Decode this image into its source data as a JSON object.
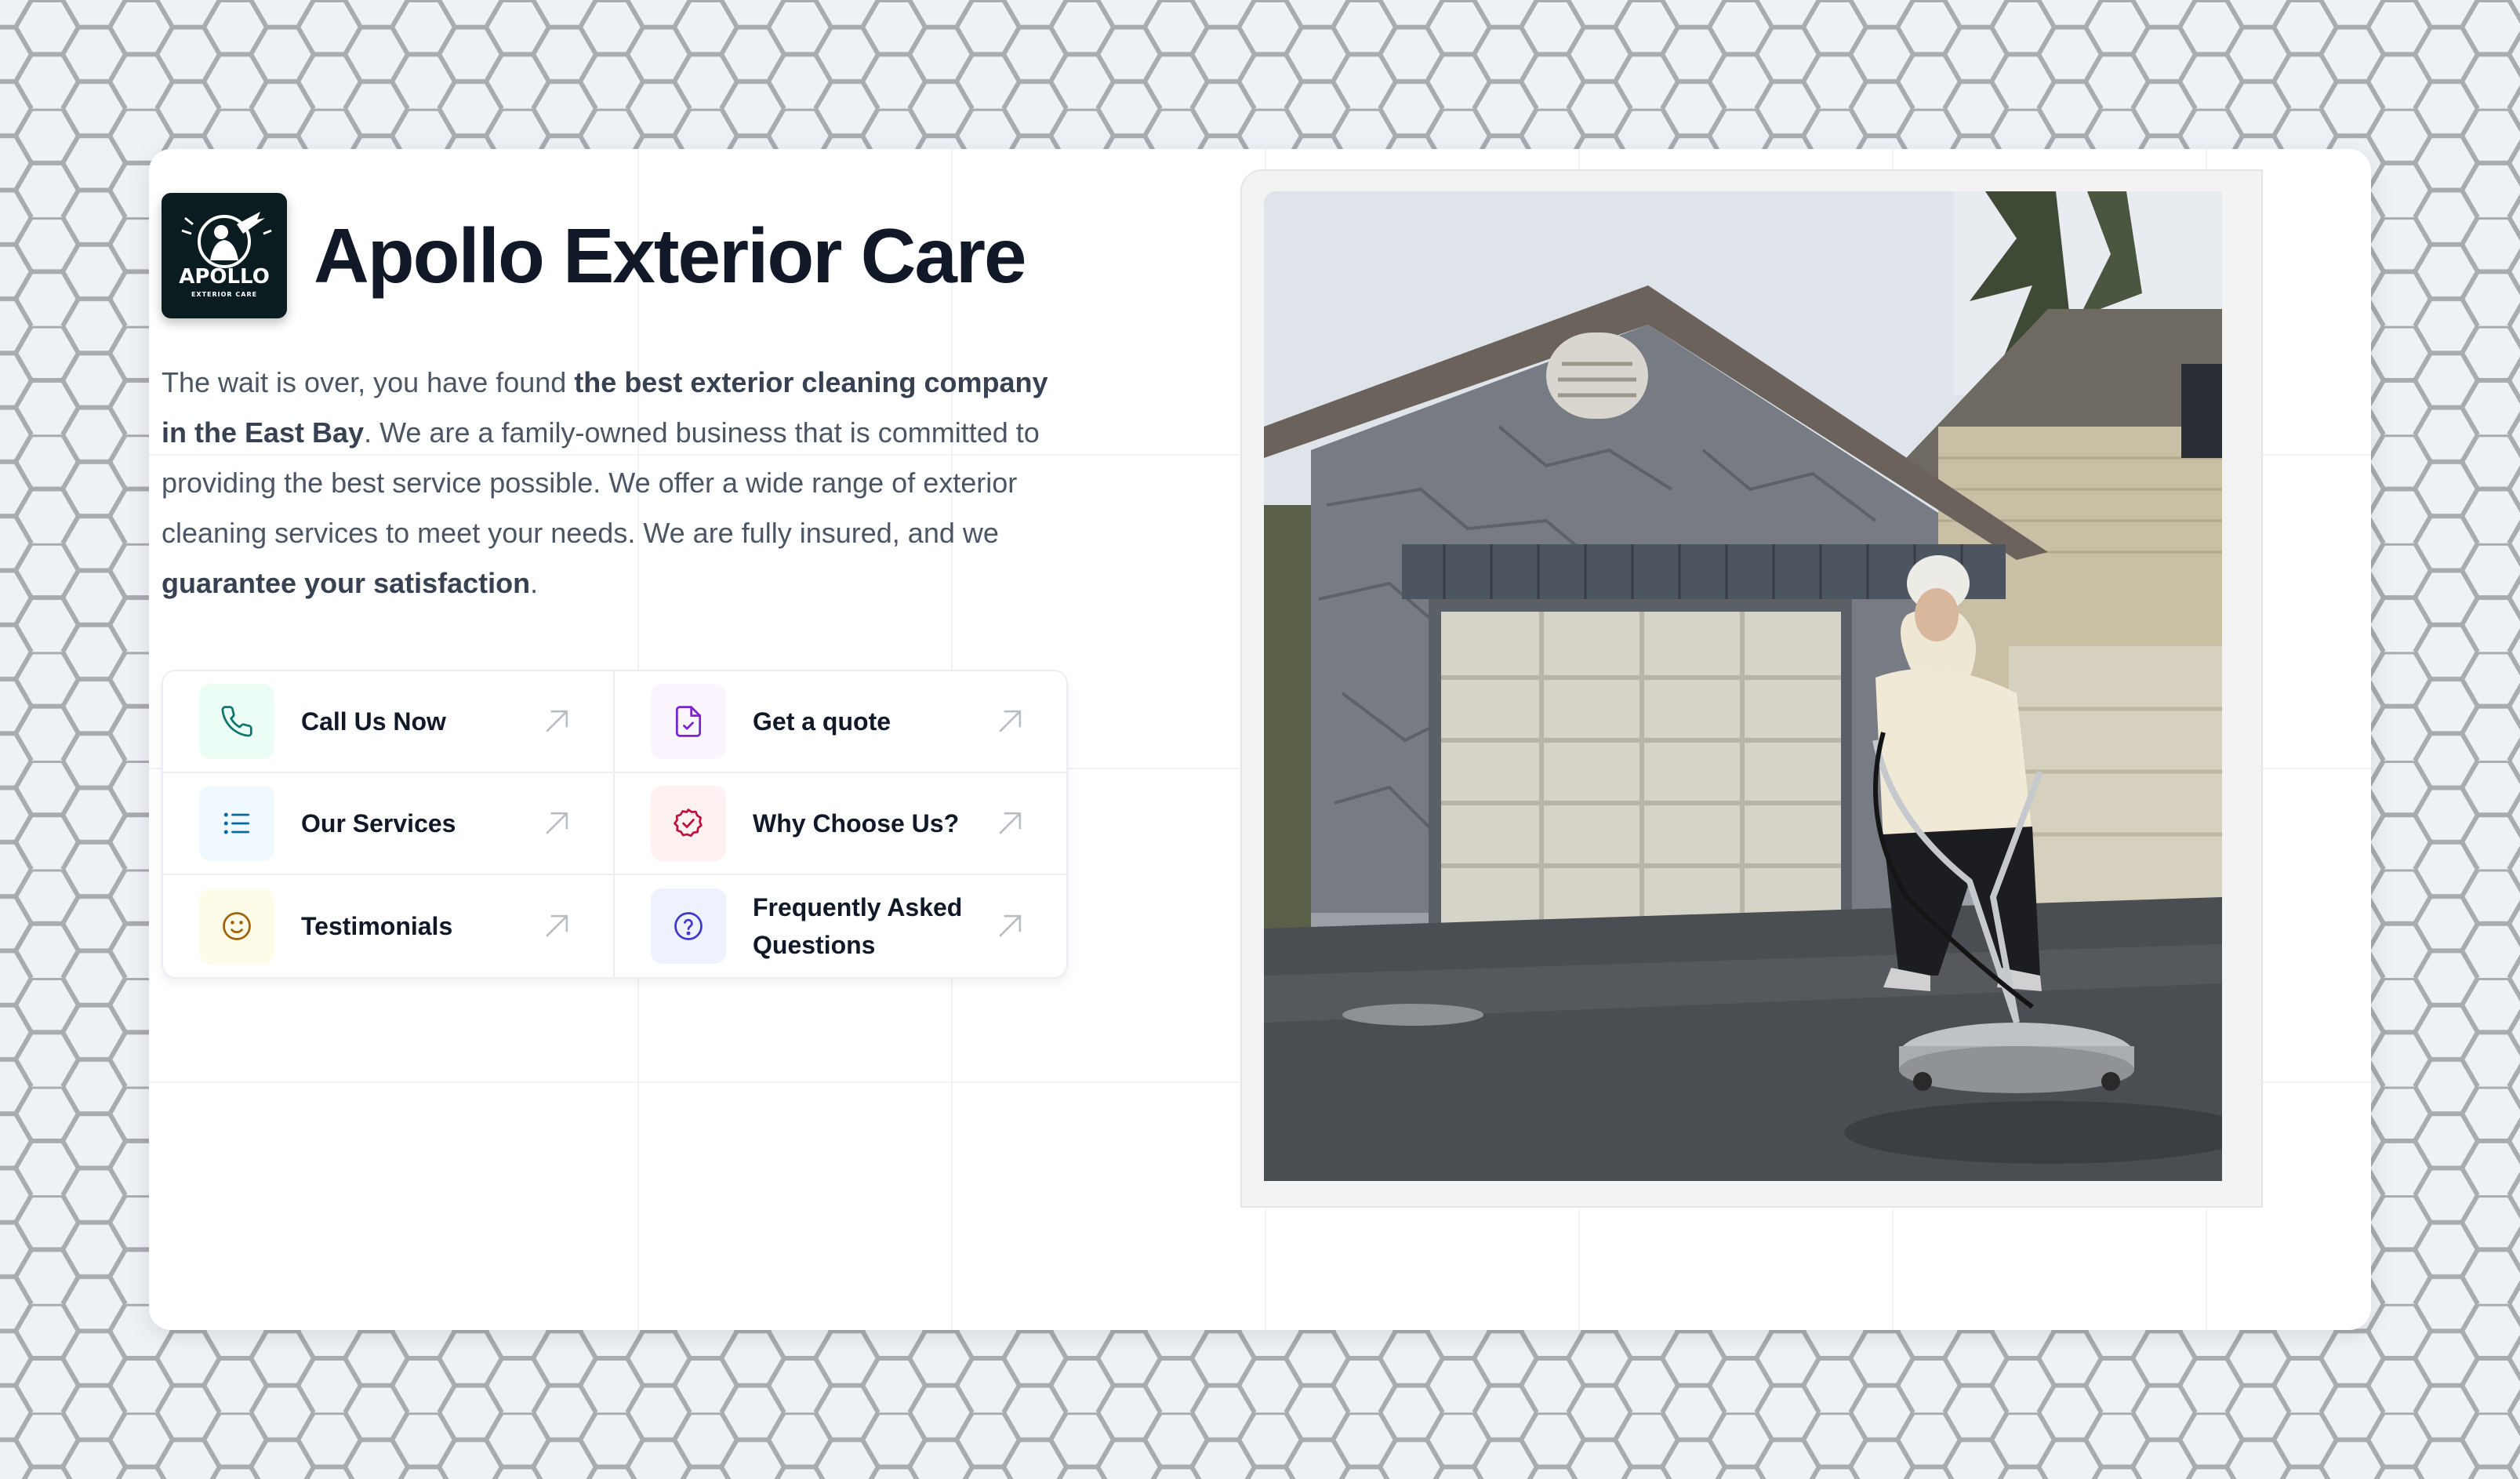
{
  "brand": {
    "logo_text": "APOLLO",
    "logo_subtext": "EXTERIOR CARE",
    "title": "Apollo Exterior Care"
  },
  "intro": {
    "p1": "The wait is over, you have found ",
    "b1": "the best exterior cleaning company in the East Bay",
    "p2": ". We are a family-owned business that is committed to providing the best service possible. We offer a wide range of exterior cleaning services to meet your needs. We are fully insured, and we ",
    "b2": "guarantee your satisfaction",
    "p3": "."
  },
  "links": [
    {
      "label": "Call Us Now",
      "icon": "phone-icon",
      "color": "#0f766e",
      "bg": "#ecfdf5"
    },
    {
      "label": "Get a quote",
      "icon": "document-check-icon",
      "color": "#7e22ce",
      "bg": "#faf5ff"
    },
    {
      "label": "Our Services",
      "icon": "list-icon",
      "color": "#0369a1",
      "bg": "#f0f9ff"
    },
    {
      "label": "Why Choose Us?",
      "icon": "badge-check-icon",
      "color": "#be123c",
      "bg": "#fff1f2"
    },
    {
      "label": "Testimonials",
      "icon": "smiley-icon",
      "color": "#a16207",
      "bg": "#fefce8"
    },
    {
      "label": "Frequently Asked Questions",
      "icon": "question-circle-icon",
      "color": "#4338ca",
      "bg": "#eef2ff"
    }
  ],
  "colors": {
    "title": "#111827",
    "body_text": "#4b5563",
    "background": "#eef1f5",
    "hex_stroke": "#a8abb0"
  }
}
